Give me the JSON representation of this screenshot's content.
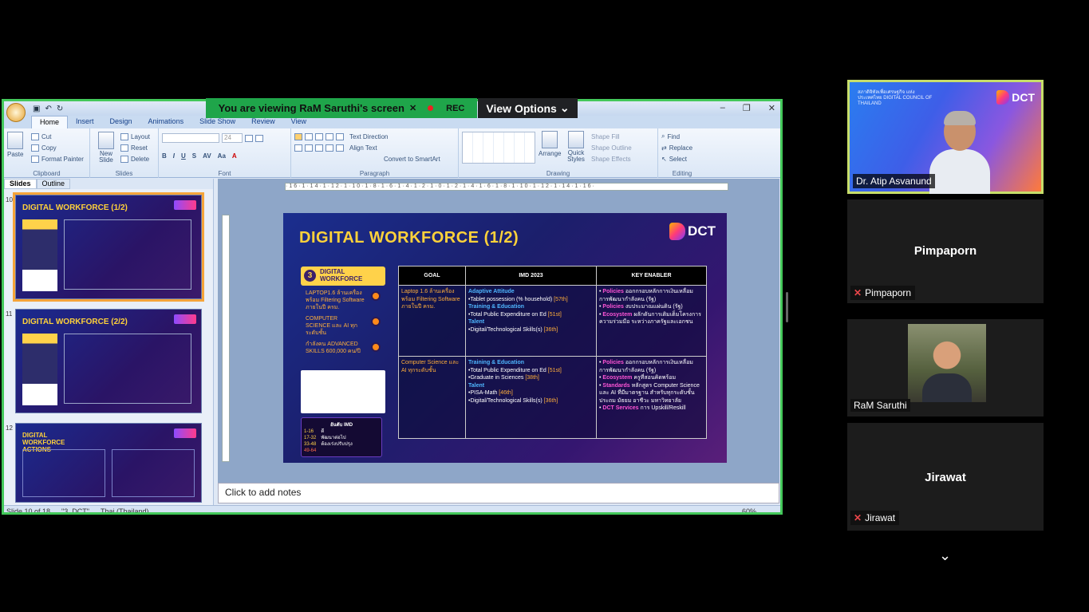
{
  "banner": {
    "viewing_text": "You are viewing RaM Saruthi's screen",
    "rec": "REC",
    "view_options": "View Options"
  },
  "ppt": {
    "tabs": [
      "Home",
      "Insert",
      "Design",
      "Animations",
      "Slide Show",
      "Review",
      "View"
    ],
    "clipboard": {
      "paste": "Paste",
      "cut": "Cut",
      "copy": "Copy",
      "format_painter": "Format Painter",
      "name": "Clipboard"
    },
    "slides_grp": {
      "new_slide": "New Slide",
      "layout": "Layout",
      "reset": "Reset",
      "delete": "Delete",
      "name": "Slides"
    },
    "font_grp": {
      "font_size": "24",
      "name": "Font"
    },
    "paragraph_grp": {
      "text_direction": "Text Direction",
      "align_text": "Align Text",
      "convert": "Convert to SmartArt",
      "name": "Paragraph"
    },
    "drawing_grp": {
      "arrange": "Arrange",
      "quick_styles": "Quick Styles",
      "shape_fill": "Shape Fill",
      "shape_outline": "Shape Outline",
      "shape_effects": "Shape Effects",
      "name": "Drawing"
    },
    "editing_grp": {
      "find": "Find",
      "replace": "Replace",
      "select": "Select",
      "name": "Editing"
    },
    "pane_tabs": {
      "slides": "Slides",
      "outline": "Outline"
    },
    "thumbs": [
      {
        "num": "10",
        "title": "DIGITAL WORKFORCE (1/2)"
      },
      {
        "num": "11",
        "title": "DIGITAL WORKFORCE (2/2)"
      },
      {
        "num": "12",
        "title": "DIGITAL WORKFORCE ACTIONS"
      }
    ],
    "notes": "Click to add notes",
    "status": {
      "slide": "Slide 10 of 18",
      "theme": "\"3_DCT\"",
      "lang": "Thai (Thailand)",
      "zoom": "60%"
    },
    "ruler": "·16·1·14·1·12·1·10·1·8·1·6·1·4·1·2·1·0·1·2·1·4·1·6·1·8·1·10·1·12·1·14·1·16·"
  },
  "slide": {
    "title": "DIGITAL WORKFORCE (1/2)",
    "logo": "DCT",
    "badge_num": "3",
    "badge_text": "DIGITAL WORKFORCE",
    "left_items": [
      "LAPTOP1.6 ล้านเครื่อง พร้อม Filtering Software ภายในปี ครม.",
      "COMPUTER SCIENCE และ AI ทุกระดับชั้น",
      "กำลังคน ADVANCED SKILLS 600,000 คน/ปี"
    ],
    "legend": {
      "head": "อันดับ IMD",
      "rows": [
        "1-16",
        "17-32",
        "33-48",
        "49-64"
      ],
      "labels": [
        "ดี",
        "พัฒนาต่อไป",
        "ต้องเร่งปรับปรุง"
      ]
    },
    "table": {
      "headers": [
        "GOAL",
        "IMD 2023",
        "KEY ENABLER"
      ],
      "rows": [
        {
          "goal": "Laptop 1.6 ล้านเครื่องพร้อม Filtering Software ภายในปี ครม.",
          "imd": [
            [
              "Adaptive Attitude",
              ""
            ],
            [
              "•Tablet possession (% household)",
              "[57th]"
            ],
            [
              "Training & Education",
              ""
            ],
            [
              "•Total Public Expenditure on Ed",
              "[51st]"
            ],
            [
              "Talent",
              ""
            ],
            [
              "•Digital/Technological Skills(s)",
              "[36th]"
            ]
          ],
          "ke": [
            [
              "Policies",
              "ออกกรอบหลักการเงินเหลื่อม การพัฒนากำลังคน (รัฐ)"
            ],
            [
              "Policies",
              "งบประมาณแผ่นดิน (รัฐ)"
            ],
            [
              "Ecosystem",
              "ผลักดันการเติมเต็มโครงการ ความร่วมมือ ระหว่างภาครัฐและเอกชน"
            ]
          ]
        },
        {
          "goal": "Computer Science และ AI ทุกระดับชั้น",
          "imd": [
            [
              "Training & Education",
              ""
            ],
            [
              "•Total Public Expenditure on Ed",
              "[51st]"
            ],
            [
              "•Graduate in Sciences",
              "[38th]"
            ],
            [
              "Talent",
              ""
            ],
            [
              "•PISA-Math",
              "[46th]"
            ],
            [
              "•Digital/Technological Skills(s)",
              "[36th]"
            ]
          ],
          "ke": [
            [
              "Policies",
              "ออกกรอบหลักการเงินเหลื่อม การพัฒนากำลังคน (รัฐ)"
            ],
            [
              "Ecosystem",
              "ครูที่สอนคิดพร้อม"
            ],
            [
              "Standards",
              "หลักสูตร Computer Science และ AI ที่มีมาตรฐาน สำหรับทุกระดับชั้น ประถม มัธยม อาชีวะ มหาวิทยาลัย"
            ],
            [
              "DCT Services",
              "การ Upskill/Reskill"
            ]
          ]
        }
      ]
    }
  },
  "participants": {
    "speaker": {
      "name": "Dr. Atip Asvanund",
      "logo": "DCT",
      "org": "สภาดิจิทัลเพื่อเศรษฐกิจ แห่งประเทศไทย DIGITAL COUNCIL OF THAILAND"
    },
    "p1": {
      "big": "Pimpaporn",
      "tag": "Pimpaporn"
    },
    "p2": {
      "tag": "RaM Saruthi"
    },
    "p3": {
      "big": "Jirawat",
      "tag": "Jirawat"
    }
  },
  "colors": {
    "share_border": "#43c85a",
    "banner": "#1fa54a",
    "speaker_border": "#c7de6a",
    "slide_title": "#ffd23a"
  }
}
